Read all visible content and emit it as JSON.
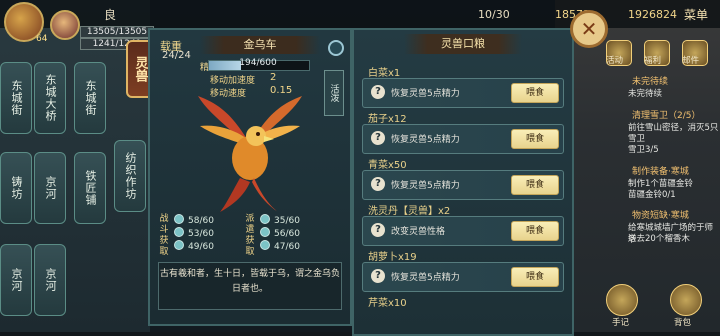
{
  "topbar": {
    "left_text": "良",
    "gold": "18572",
    "coins": "1926824",
    "menu": "菜单",
    "time_stat": "10/30"
  },
  "player": {
    "hp": "13505/13505",
    "mp": "1241/1241",
    "level_badge": "64"
  },
  "map_tabs": [
    "东城街",
    "东城大桥",
    "东城街",
    "京河",
    "铁匠铺",
    "纺织作坊",
    "京河",
    "铸坊",
    "京河"
  ],
  "spirit_tab": "灵兽",
  "panel": {
    "carry_label": "载重",
    "carry_val": "24/24",
    "name": "金乌车",
    "xp": "194/600",
    "xp_ratio": 0.323,
    "attr1_label": "移动加速度",
    "attr1_val": "2",
    "attr2_label": "移动速度",
    "attr2_val": "0.15",
    "side_badge": "活泼",
    "stat_group1": "战斗获取",
    "stat_group2": "派遣获取",
    "stats_left": [
      "58/60",
      "53/60",
      "49/60"
    ],
    "stats_right": [
      "35/60",
      "56/60",
      "47/60"
    ],
    "description": "古有羲和者，生十日，皆载于乌，谓之金乌负日者也。"
  },
  "food_panel": {
    "title": "灵兽口粮",
    "items": [
      {
        "name": "白菜x1",
        "desc": "恢复灵兽5点精力",
        "btn": "喂食"
      },
      {
        "name": "茄子x12",
        "desc": "恢复灵兽5点精力",
        "btn": "喂食"
      },
      {
        "name": "青菜x50",
        "desc": "恢复灵兽5点精力",
        "btn": "喂食"
      },
      {
        "name": "洗灵丹【灵兽】x2",
        "desc": "改变灵兽性格",
        "btn": "喂食"
      },
      {
        "name": "胡萝卜x19",
        "desc": "恢复灵兽5点精力",
        "btn": "喂食"
      },
      {
        "name": "芹菜x10",
        "desc": "",
        "btn": ""
      }
    ]
  },
  "right_hud": {
    "icons": [
      "活动",
      "福利",
      "邮件"
    ],
    "quests": [
      {
        "title": "未完待续",
        "lines": [
          "未完待续"
        ]
      },
      {
        "title": "清理雪卫（2/5）",
        "lines": [
          "前往雪山密径，消灭5只",
          "雪卫",
          "雪卫3/5"
        ]
      },
      {
        "title": "制作装备·寒城",
        "lines": [
          "制作1个苗疆金铃",
          "苗疆金铃0/1"
        ]
      },
      {
        "title": "物资短缺·寒城",
        "lines": [
          "给寒城城墙广场的于师爷",
          "送去20个榴香木"
        ]
      }
    ],
    "bottom_left": "手记",
    "bottom_right": "背包"
  },
  "colors": {
    "accent": "#e8d38d",
    "panel_bg": "#223840",
    "gold_text": "#f1d58a"
  }
}
